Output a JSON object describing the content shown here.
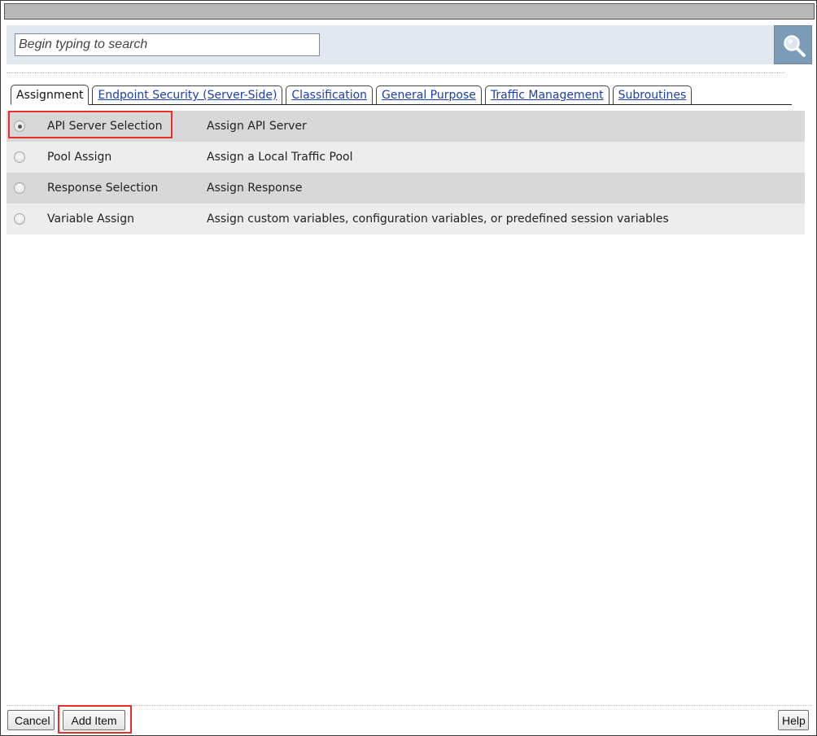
{
  "search": {
    "placeholder": "Begin typing to search",
    "button_icon": "magnifier-icon"
  },
  "tabs": [
    {
      "label": "Assignment",
      "active": true
    },
    {
      "label": "Endpoint Security (Server-Side)",
      "active": false
    },
    {
      "label": "Classification",
      "active": false
    },
    {
      "label": "General Purpose",
      "active": false
    },
    {
      "label": "Traffic Management",
      "active": false
    },
    {
      "label": "Subroutines",
      "active": false
    }
  ],
  "items": [
    {
      "name": "API Server Selection",
      "description": "Assign API Server",
      "selected": true
    },
    {
      "name": "Pool Assign",
      "description": "Assign a Local Traffic Pool",
      "selected": false
    },
    {
      "name": "Response Selection",
      "description": "Assign Response",
      "selected": false
    },
    {
      "name": "Variable Assign",
      "description": "Assign custom variables, configuration variables, or predefined session variables",
      "selected": false
    }
  ],
  "footer": {
    "cancel_label": "Cancel",
    "add_label": "Add Item",
    "help_label": "Help"
  },
  "colors": {
    "highlight": "#e8302a",
    "search_bar_bg": "#e1e8f0",
    "search_button_bg": "#7b9bb6",
    "tab_link": "#1a3fb0",
    "row_odd": "#d8d8d8",
    "row_even": "#ededed"
  }
}
